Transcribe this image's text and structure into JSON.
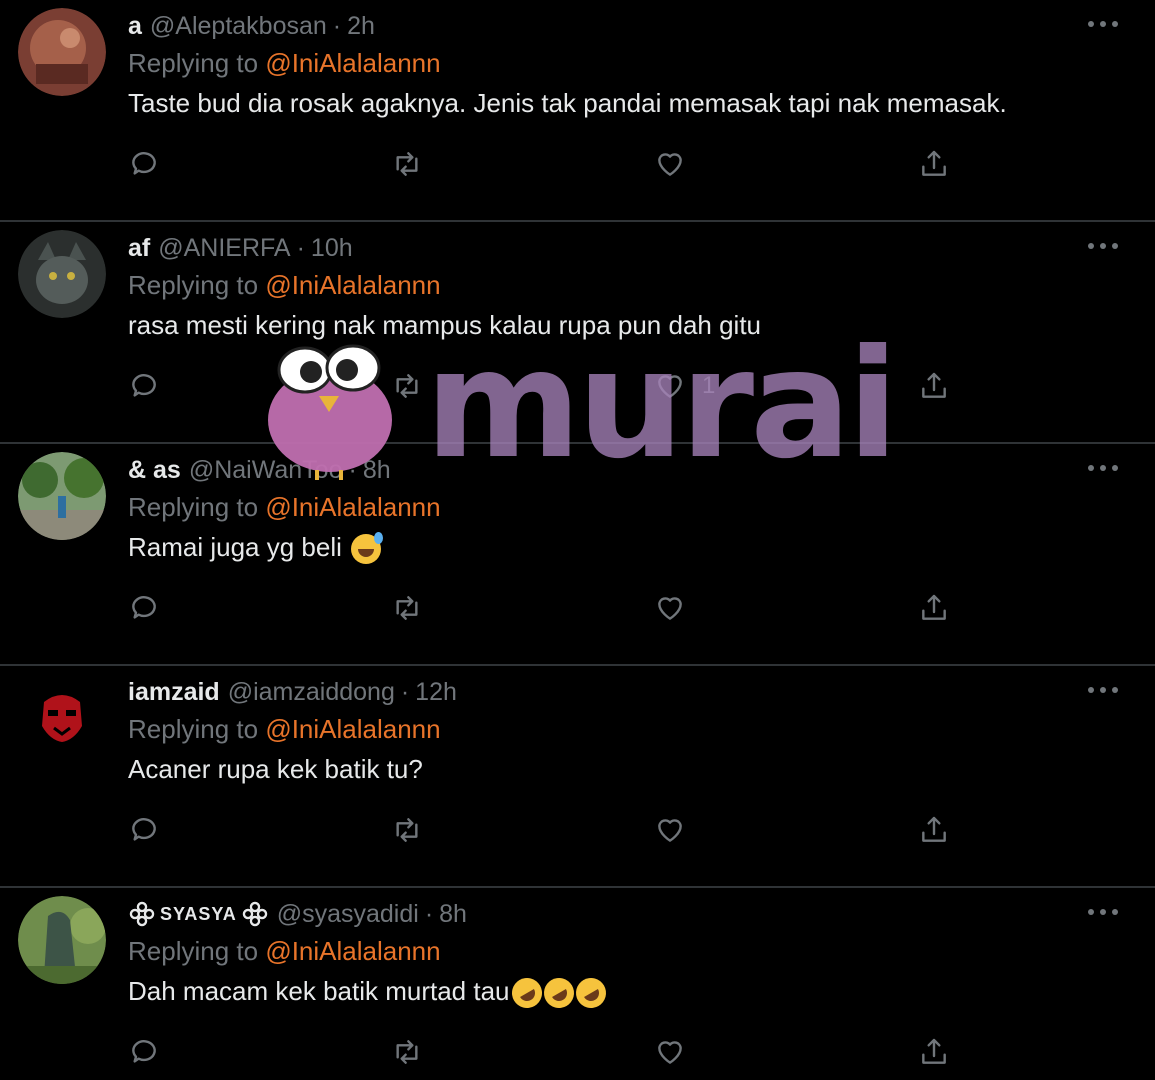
{
  "replies": [
    {
      "name": "a",
      "handle": "@Aleptakbosan",
      "time": "2h",
      "replying_prefix": "Replying to",
      "replying_to": "@IniAlalalannn",
      "text": "Taste bud dia rosak agaknya. Jenis tak pandai memasak tapi nak memasak.",
      "emojis": [],
      "avatar_color": "#8a4a3c"
    },
    {
      "name": "af",
      "handle": "@ANIERFA",
      "time": "10h",
      "replying_prefix": "Replying to",
      "replying_to": "@IniAlalalannn",
      "text": "rasa mesti kering nak mampus kalau rupa pun dah gitu",
      "emojis": [],
      "like_count": "1",
      "avatar_color": "#3a3f3d"
    },
    {
      "name": "& as",
      "handle": "@NaiWanToo",
      "time": "8h",
      "replying_prefix": "Replying to",
      "replying_to": "@IniAlalalannn",
      "text": "Ramai juga yg beli",
      "emojis": [
        "grinning-sweat-emoji"
      ],
      "avatar_color": "#5b7a4a"
    },
    {
      "name": "iamzaid",
      "handle": "@iamzaiddong",
      "time": "12h",
      "replying_prefix": "Replying to",
      "replying_to": "@IniAlalalannn",
      "text": "Acaner rupa kek batik tu?",
      "emojis": [],
      "avatar_color": "#000000"
    },
    {
      "name": "SYASYA",
      "handle": "@syasyadidi",
      "time": "8h",
      "replying_prefix": "Replying to",
      "replying_to": "@IniAlalalannn",
      "text": "Dah macam kek batik murtad tau",
      "emojis": [
        "rofl-emoji",
        "rofl-emoji",
        "rofl-emoji"
      ],
      "name_icons": [
        "flower-icon",
        "flower-icon"
      ],
      "avatar_color": "#4a6a3a"
    }
  ],
  "watermark": {
    "text": "murai",
    "icon": "bird-mascot-icon"
  },
  "colors": {
    "background": "#000000",
    "primary_text": "#e7e9ea",
    "secondary_text": "#71767b",
    "mention": "#e8742a",
    "divider": "#2f3336",
    "watermark": "#a582b9"
  },
  "icons": [
    "reply-icon",
    "retweet-icon",
    "like-icon",
    "share-icon",
    "more-icon"
  ]
}
